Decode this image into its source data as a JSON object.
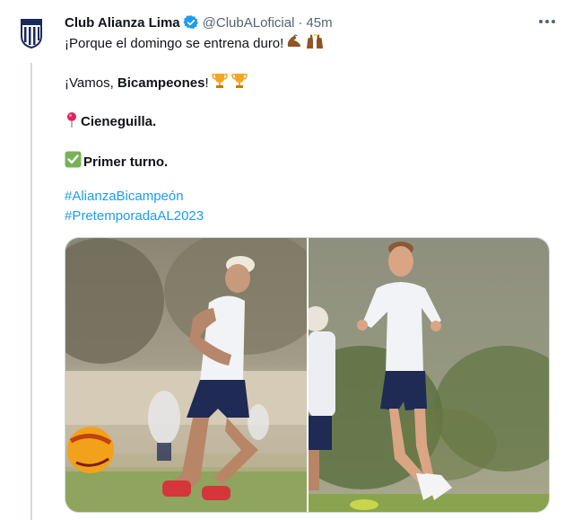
{
  "tweet": {
    "author": {
      "display_name": "Club Alianza Lima",
      "handle": "@ClubALoficial",
      "separator": "·",
      "time": "45m",
      "verified": true,
      "avatar_icon": "alianza-lima-crest-icon"
    },
    "more_icon": "more-options-icon",
    "lines": {
      "line1_text": "¡Porque el domingo se entrena duro!",
      "line1_emojis": [
        "flexed-biceps-icon",
        "raising-hands-icon"
      ],
      "line2_prefix": "¡Vamos, ",
      "line2_bold": "Bicampeones",
      "line2_suffix": "!",
      "line2_emojis": [
        "trophy-icon",
        "trophy-icon"
      ],
      "line3_emoji": "round-pushpin-icon",
      "line3_text": "Cieneguilla.",
      "line4_emoji": "check-mark-button-icon",
      "line4_text": "Primer turno."
    },
    "hashtags": [
      "#AlianzaBicampeón",
      "#PretemporadaAL2023"
    ],
    "media": [
      {
        "description_icon": "photo-player-with-ball"
      },
      {
        "description_icon": "photo-player-jumping"
      }
    ],
    "colors": {
      "link": "#1d9bf0",
      "secondary_text": "#536471",
      "verified": "#1d9bf0",
      "border": "#cfd9de"
    }
  }
}
